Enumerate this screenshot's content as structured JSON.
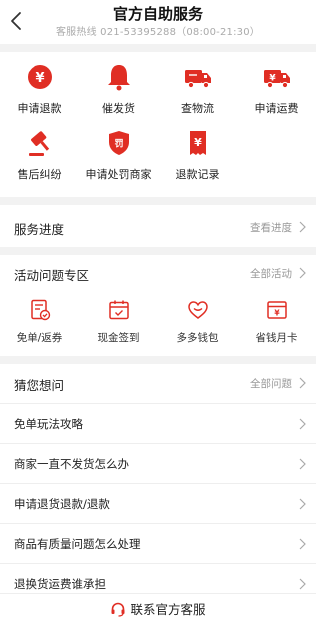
{
  "header": {
    "title": "官方自助服务",
    "hotline": "客服热线 021-53395288（08:00-21:30）"
  },
  "services": [
    {
      "label": "申请退款",
      "icon": "refund-coin-icon"
    },
    {
      "label": "催发货",
      "icon": "bell-icon"
    },
    {
      "label": "查物流",
      "icon": "delivery-truck-icon"
    },
    {
      "label": "申请运费",
      "icon": "freight-truck-icon"
    },
    {
      "label": "售后纠纷",
      "icon": "gavel-icon"
    },
    {
      "label": "申请处罚商家",
      "icon": "penalty-shield-icon"
    },
    {
      "label": "退款记录",
      "icon": "refund-receipt-icon"
    }
  ],
  "progress": {
    "title": "服务进度",
    "link": "查看进度"
  },
  "activity": {
    "title": "活动问题专区",
    "link": "全部活动",
    "items": [
      {
        "label": "免单/返券",
        "icon": "coupon-document-icon"
      },
      {
        "label": "现金签到",
        "icon": "calendar-check-icon"
      },
      {
        "label": "多多钱包",
        "icon": "heart-wallet-icon"
      },
      {
        "label": "省钱月卡",
        "icon": "money-card-icon"
      }
    ]
  },
  "faq": {
    "title": "猜您想问",
    "link": "全部问题",
    "questions": [
      "免单玩法攻略",
      "商家一直不发货怎么办",
      "申请退货退款/退款",
      "商品有质量问题怎么处理",
      "退换货运费谁承担"
    ]
  },
  "footer": {
    "label": "联系官方客服",
    "icon": "headset-icon"
  },
  "colors": {
    "accent": "#e02e24",
    "separator": "#f2f2f2"
  }
}
